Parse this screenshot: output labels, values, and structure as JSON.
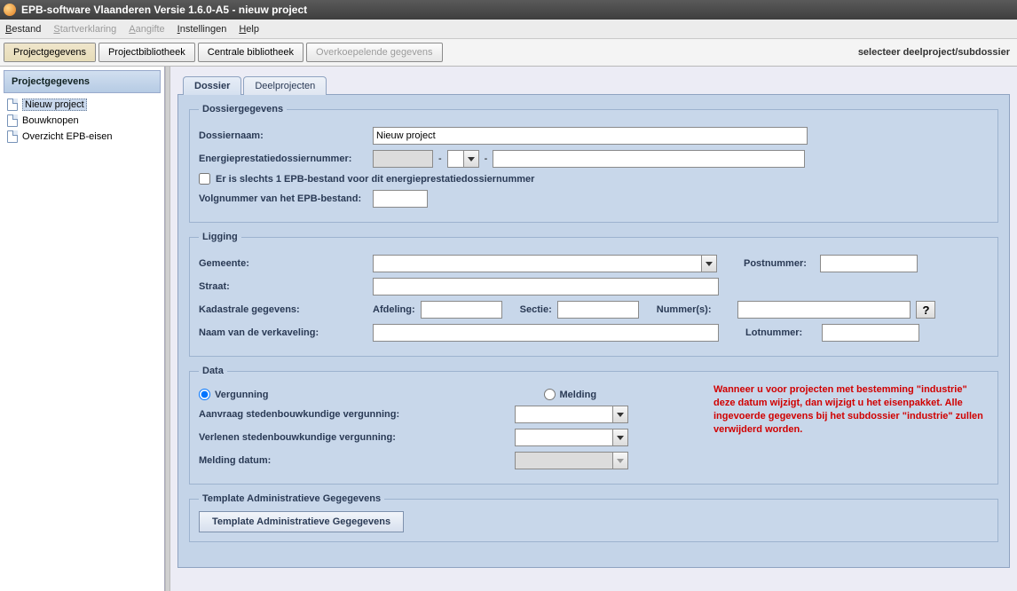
{
  "titlebar": {
    "title": "EPB-software Vlaanderen Versie 1.6.0-A5 - nieuw project"
  },
  "menu": {
    "bestand": "Bestand",
    "startverklaring": "Startverklaring",
    "aangifte": "Aangifte",
    "instellingen": "Instellingen",
    "help": "Help"
  },
  "toolbar": {
    "tabs": [
      "Projectgegevens",
      "Projectbibliotheek",
      "Centrale bibliotheek"
    ],
    "disabled_tab": "Overkoepelende gegevens",
    "right_label": "selecteer deelproject/subdossier"
  },
  "tree": {
    "header": "Projectgegevens",
    "items": [
      "Nieuw project",
      "Bouwknopen",
      "Overzicht EPB-eisen"
    ],
    "selected_index": 0
  },
  "tabs": {
    "dossier": "Dossier",
    "deelprojecten": "Deelprojecten"
  },
  "dossiergegevens": {
    "legend": "Dossiergegevens",
    "dossiernaam_label": "Dossiernaam:",
    "dossiernaam_value": "Nieuw project",
    "epd_label": "Energieprestatiedossiernummer:",
    "checkbox_label": "Er is slechts 1 EPB-bestand voor dit energieprestatiedossiernummer",
    "volgnummer_label": "Volgnummer van het EPB-bestand:"
  },
  "ligging": {
    "legend": "Ligging",
    "gemeente_label": "Gemeente:",
    "postnummer_label": "Postnummer:",
    "straat_label": "Straat:",
    "kadastraal_label": "Kadastrale gegevens:",
    "afdeling_label": "Afdeling:",
    "sectie_label": "Sectie:",
    "nummers_label": "Nummer(s):",
    "help": "?",
    "verkaveling_label": "Naam van de verkaveling:",
    "lotnummer_label": "Lotnummer:"
  },
  "data": {
    "legend": "Data",
    "vergunning": "Vergunning",
    "melding": "Melding",
    "warning": "Wanneer u voor projecten met bestemming \"industrie\" deze datum wijzigt, dan wijzigt u het eisenpakket. Alle ingevoerde gegevens bij het subdossier \"industrie\" zullen verwijderd worden.",
    "aanvraag_label": "Aanvraag stedenbouwkundige vergunning:",
    "verlenen_label": "Verlenen stedenbouwkundige vergunning:",
    "melding_datum_label": "Melding datum:"
  },
  "template": {
    "legend": "Template Administratieve Gegegevens",
    "button": "Template Administratieve Gegegevens"
  }
}
